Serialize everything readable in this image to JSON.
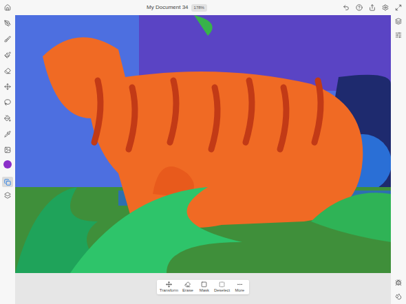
{
  "top_bar": {
    "title": "My Document 34",
    "zoom": "178%"
  },
  "left_tools": [
    {
      "selected": false
    },
    {
      "selected": false
    },
    {
      "selected": false
    },
    {
      "selected": false
    },
    {
      "selected": false
    },
    {
      "selected": false
    },
    {
      "selected": false
    },
    {
      "selected": false
    },
    {
      "selected": false
    }
  ],
  "current_color": "#8b2fc9",
  "layer_tools": [
    {
      "selected": true
    },
    {
      "selected": false
    }
  ],
  "selection_toolbar": [
    {
      "label": "Transform"
    },
    {
      "label": "Erase"
    },
    {
      "label": "Mask"
    },
    {
      "label": "Deselect"
    },
    {
      "label": "More"
    }
  ]
}
